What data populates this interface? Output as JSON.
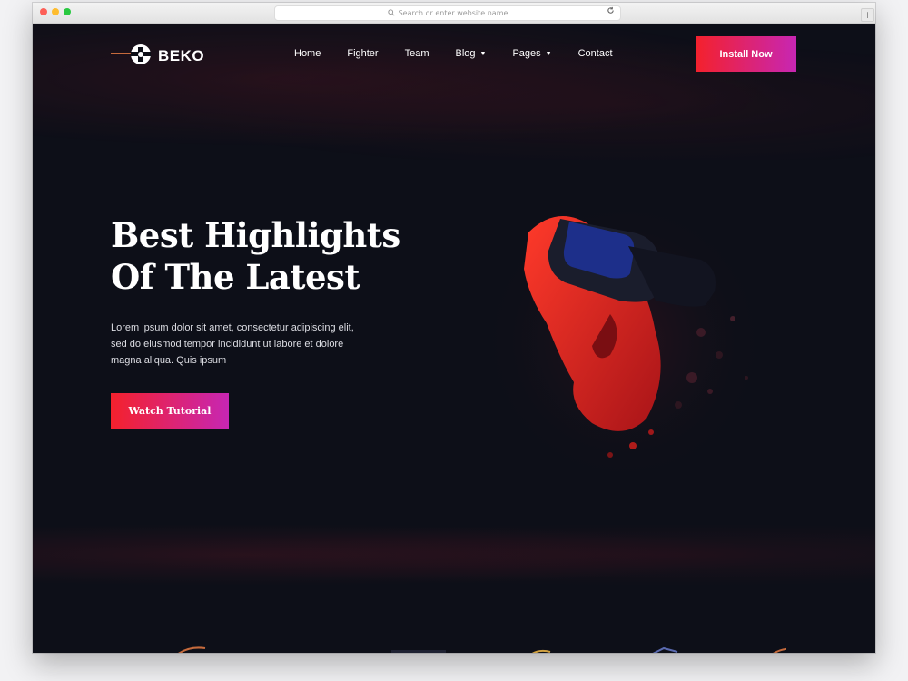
{
  "browser": {
    "url_placeholder": "Search or enter website name"
  },
  "brand": {
    "name": "BEKO"
  },
  "nav": {
    "items": [
      {
        "label": "Home",
        "dropdown": false
      },
      {
        "label": "Fighter",
        "dropdown": false
      },
      {
        "label": "Team",
        "dropdown": false
      },
      {
        "label": "Blog",
        "dropdown": true
      },
      {
        "label": "Pages",
        "dropdown": true
      },
      {
        "label": "Contact",
        "dropdown": false
      }
    ],
    "cta_label": "Install Now"
  },
  "hero": {
    "headline_line1": "Best Highlights",
    "headline_line2": "Of The Latest",
    "paragraph_line1": "Lorem ipsum dolor sit amet, consectetur adipiscing elit,",
    "paragraph_line2": "sed do eiusmod tempor incididunt ut labore et dolore",
    "paragraph_line3": "magna aliqua. Quis ipsum",
    "cta_label": "Watch Tutorial"
  },
  "colors": {
    "background": "#0d0f18",
    "gradient_start": "#f4212c",
    "gradient_end": "#c726b3",
    "text": "#ffffff"
  },
  "icons": {
    "logo": "beko-logo-icon",
    "reload": "reload-icon",
    "search": "search-icon",
    "new_tab": "plus-icon"
  }
}
